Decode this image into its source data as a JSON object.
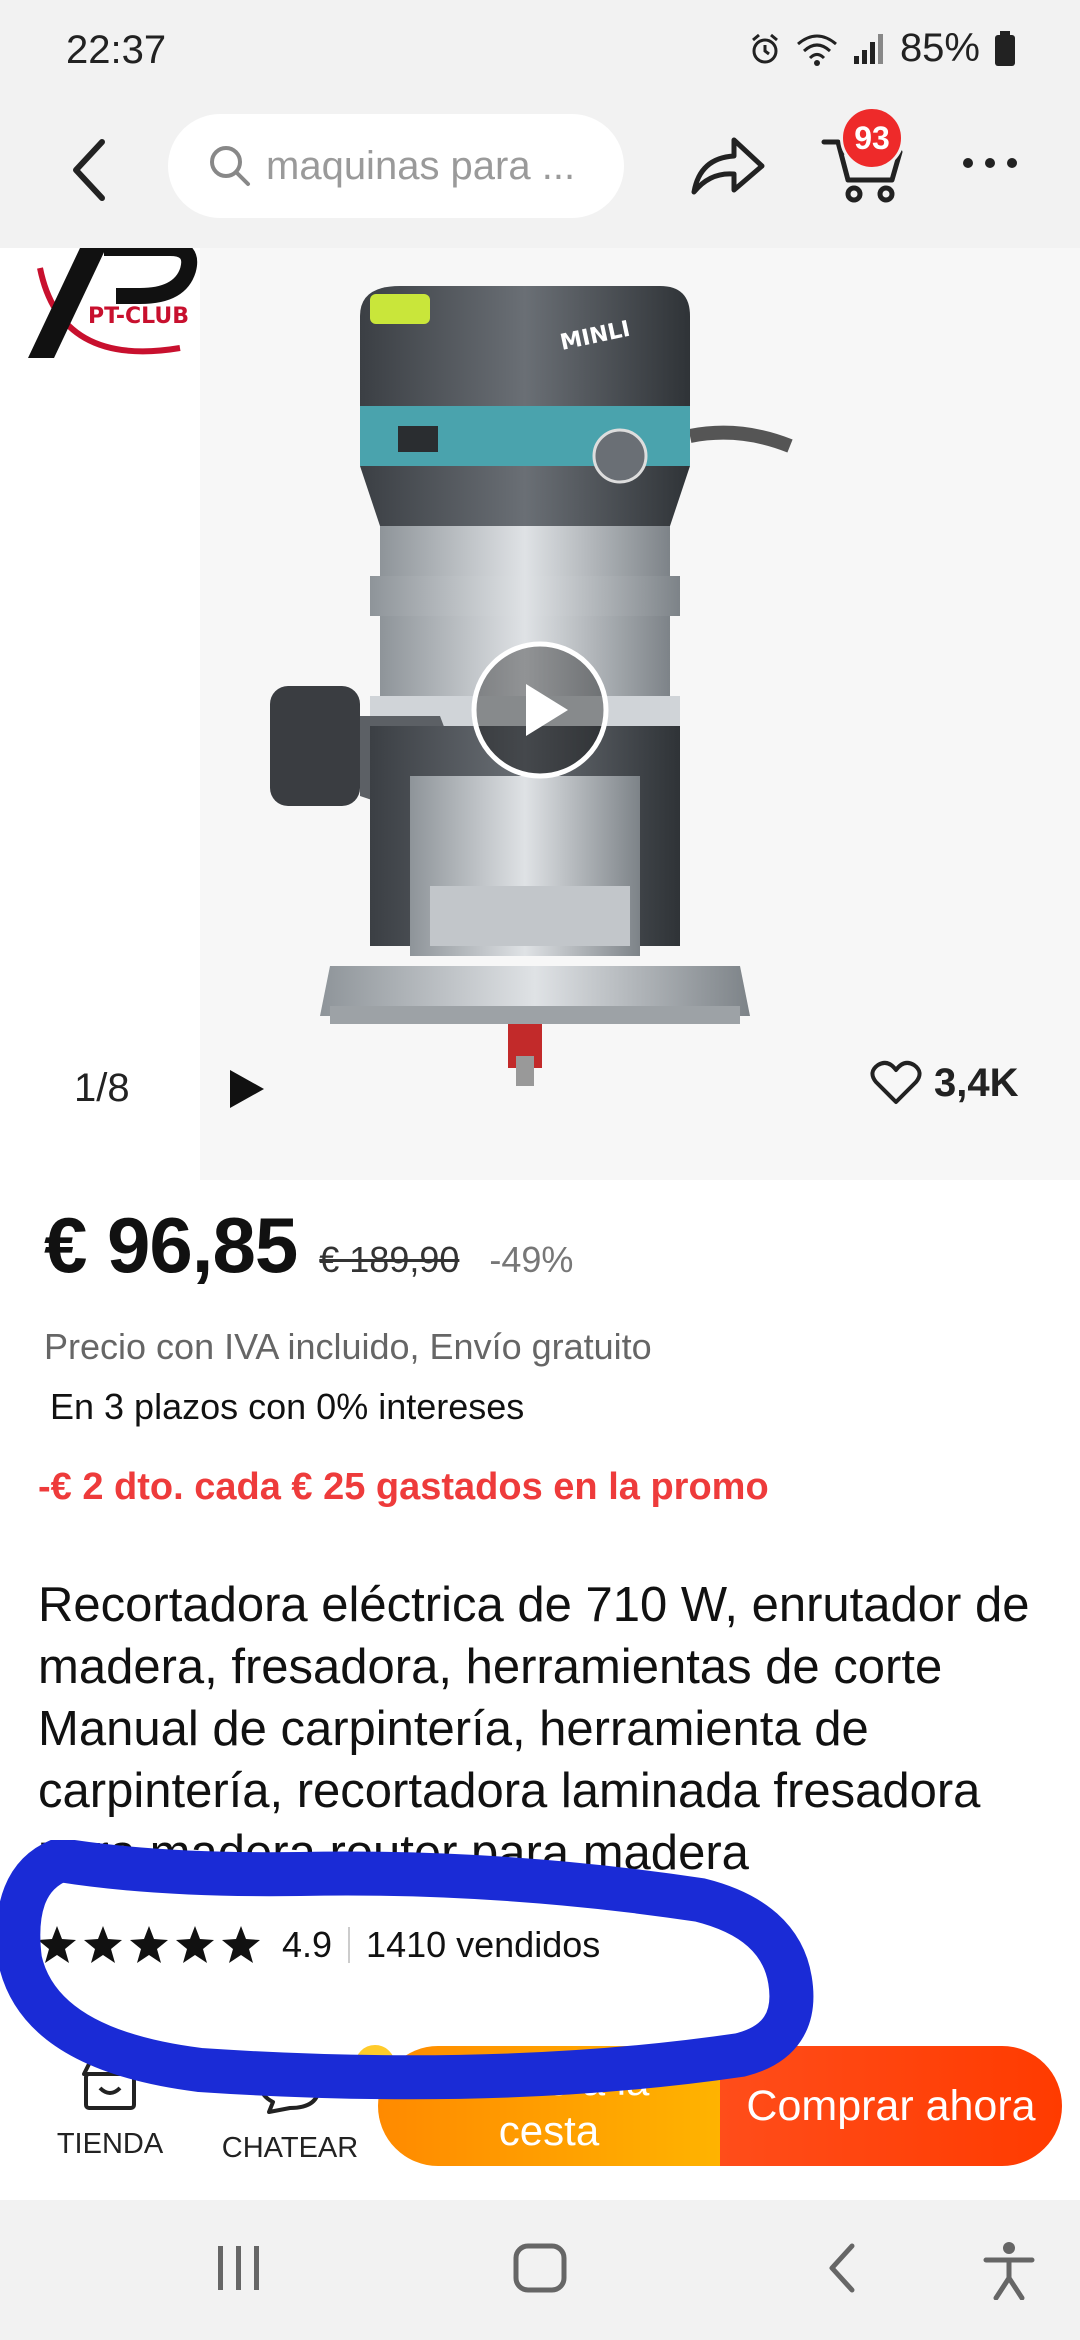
{
  "status_bar": {
    "time": "22:37",
    "battery": "85%"
  },
  "nav": {
    "search_placeholder": "maquinas para ...",
    "cart_count": "93"
  },
  "gallery": {
    "brand_logo_text": "PT-CLUB",
    "product_brand": "MINLI",
    "counter": "1/8",
    "wishlist_count": "3,4K"
  },
  "price": {
    "current": "€ 96,85",
    "original": "€ 189,90",
    "discount": "-49%",
    "tax_info": "Precio con IVA incluido, Envío gratuito",
    "installments": "En 3 plazos con 0% intereses",
    "promo": "-€ 2 dto. cada € 25 gastados en la promo"
  },
  "product": {
    "title": "Recortadora eléctrica de 710 W, enrutador de madera, fresadora, herramientas de corte Manual de carpintería, herramienta de carpintería, recortadora laminada fresadora para madera router para madera",
    "rating": "4.9",
    "rating_stars": 5,
    "sold": "1410 vendidos"
  },
  "actions": {
    "store_label": "TIENDA",
    "chat_label": "CHATEAR",
    "add_to_cart": "Añade a la cesta",
    "buy_now": "Comprar ahora"
  },
  "colors": {
    "price_promo": "#ee3b3b",
    "cart_badge": "#ee2a2a",
    "cart_cta": "#ff9a00",
    "buy_cta": "#ff4515",
    "annotation": "#1a2bd6"
  },
  "icons": {
    "back": "back-arrow-icon",
    "search": "search-icon",
    "share": "share-icon",
    "cart": "cart-icon",
    "more": "more-dots-icon",
    "play": "play-icon",
    "heart": "heart-icon",
    "store": "store-icon",
    "chat": "chat-icon"
  }
}
